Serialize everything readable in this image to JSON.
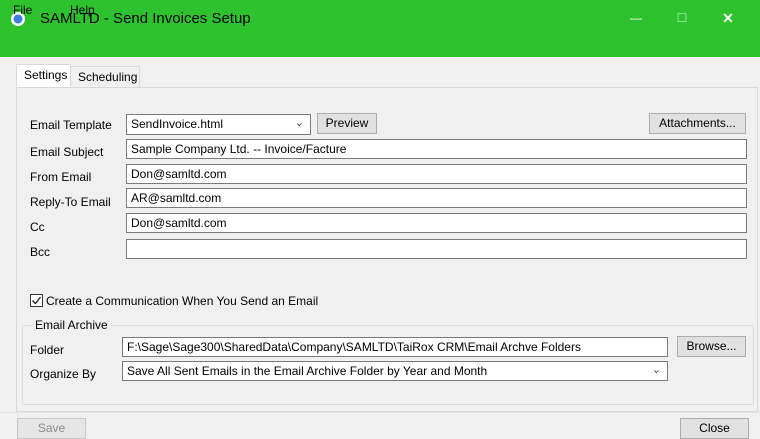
{
  "window": {
    "title": "SAMLTD - Send Invoices Setup",
    "titlebar_color": "#2ec32e",
    "minimize_glyph": "—",
    "maximize_glyph": "☐",
    "close_glyph": "✕"
  },
  "menu": {
    "file": "File",
    "help": "Help"
  },
  "tabs": [
    {
      "label": "Settings",
      "active": true
    },
    {
      "label": "Scheduling",
      "active": false
    }
  ],
  "form": {
    "email_template": {
      "label": "Email Template",
      "value": "SendInvoice.html"
    },
    "preview_button": "Preview",
    "attachments_button": "Attachments...",
    "email_subject": {
      "label": "Email Subject",
      "value": "Sample Company Ltd. -- Invoice/Facture"
    },
    "from_email": {
      "label": "From Email",
      "value": "Don@samltd.com"
    },
    "reply_to_email": {
      "label": "Reply-To Email",
      "value": "AR@samltd.com"
    },
    "cc": {
      "label": "Cc",
      "value": "Don@samltd.com"
    },
    "bcc": {
      "label": "Bcc",
      "value": ""
    },
    "create_communication": {
      "label": "Create a Communication When You Send an Email",
      "checked": true
    }
  },
  "archive": {
    "group_label": "Email Archive",
    "folder": {
      "label": "Folder",
      "value": "F:\\Sage\\Sage300\\SharedData\\Company\\SAMLTD\\TaiRox CRM\\Email Archve Folders"
    },
    "browse_button": "Browse...",
    "organize_by": {
      "label": "Organize By",
      "value": "Save All Sent Emails in the Email Archive Folder by Year and Month"
    }
  },
  "footer": {
    "save_button": "Save",
    "close_button": "Close"
  }
}
